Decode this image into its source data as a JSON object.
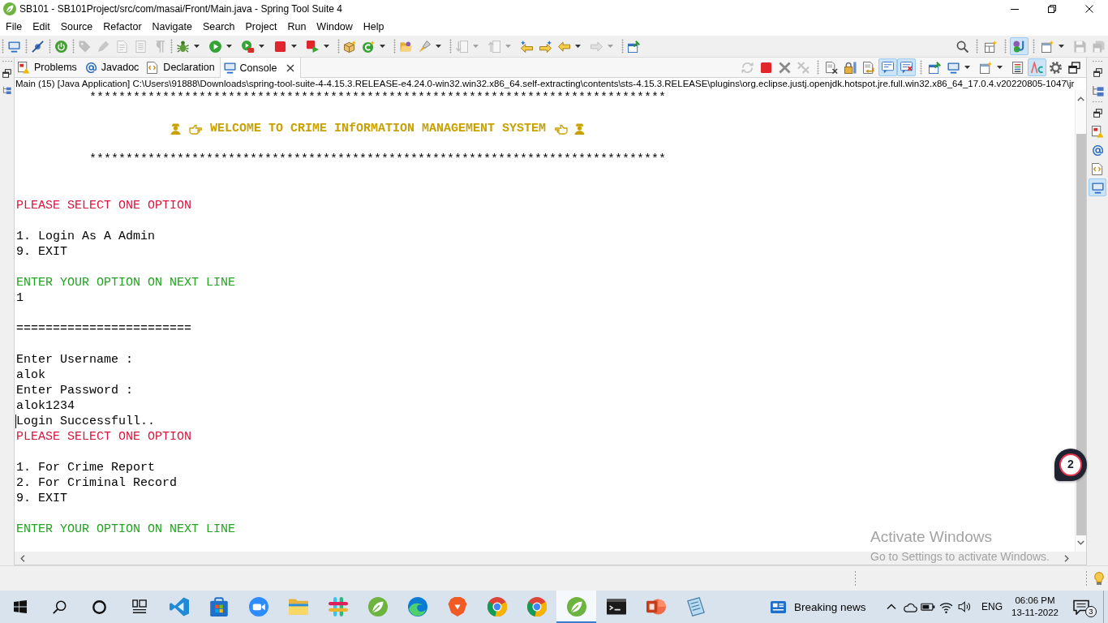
{
  "window": {
    "title": "SB101 - SB101Project/src/com/masai/Front/Main.java - Spring Tool Suite 4"
  },
  "menu": [
    "File",
    "Edit",
    "Source",
    "Refactor",
    "Navigate",
    "Search",
    "Project",
    "Run",
    "Window",
    "Help"
  ],
  "main_toolbar": {
    "left": [
      {
        "kind": "separator"
      },
      {
        "kind": "console",
        "disabled": false
      },
      {
        "kind": "separator"
      },
      {
        "kind": "skip-breakpoints",
        "disabled": false
      },
      {
        "kind": "separator"
      },
      {
        "kind": "dashboard",
        "disabled": false
      },
      {
        "kind": "separator"
      },
      {
        "kind": "annotation",
        "disabled": true
      },
      {
        "kind": "highlight",
        "disabled": true
      },
      {
        "kind": "format",
        "disabled": true
      },
      {
        "kind": "block-selection",
        "disabled": true
      },
      {
        "kind": "whitespace",
        "disabled": true
      },
      {
        "kind": "separator"
      },
      {
        "kind": "debug",
        "disabled": false,
        "dropdown": true
      },
      {
        "kind": "run",
        "disabled": false,
        "dropdown": true
      },
      {
        "kind": "coverage",
        "disabled": false,
        "dropdown": true
      },
      {
        "kind": "terminate",
        "disabled": false,
        "dropdown": true
      },
      {
        "kind": "launch",
        "disabled": false,
        "dropdown": true
      },
      {
        "kind": "separator"
      },
      {
        "kind": "new-package",
        "disabled": false
      },
      {
        "kind": "new-class",
        "disabled": false,
        "dropdown": true
      },
      {
        "kind": "separator"
      },
      {
        "kind": "open-type",
        "disabled": false
      },
      {
        "kind": "search",
        "disabled": false,
        "dropdown": true
      },
      {
        "kind": "separator"
      },
      {
        "kind": "next-annotation",
        "disabled": true,
        "dropdown": true
      },
      {
        "kind": "previous-annotation",
        "disabled": true,
        "dropdown": true
      },
      {
        "kind": "last-edit",
        "disabled": false
      },
      {
        "kind": "next-edit",
        "disabled": false
      },
      {
        "kind": "back",
        "disabled": false,
        "dropdown": true
      },
      {
        "kind": "forward",
        "disabled": true,
        "dropdown": true
      },
      {
        "kind": "separator"
      },
      {
        "kind": "pin-editor",
        "disabled": false
      }
    ],
    "right": [
      {
        "kind": "find",
        "disabled": false,
        "pressed": false
      },
      {
        "kind": "separator"
      },
      {
        "kind": "open-perspective",
        "disabled": false,
        "pressed": false
      },
      {
        "kind": "separator"
      },
      {
        "kind": "perspective",
        "disabled": false,
        "pressed": true
      },
      {
        "kind": "separator"
      },
      {
        "kind": "new-window",
        "disabled": false,
        "pressed": false,
        "dropdown": true
      },
      {
        "kind": "save",
        "disabled": true,
        "pressed": false
      },
      {
        "kind": "save-all",
        "disabled": true,
        "pressed": false
      }
    ]
  },
  "left_trim": [
    {
      "kind": "restore"
    },
    {
      "kind": "outline"
    }
  ],
  "views": {
    "tabs": [
      {
        "label": "Problems",
        "kind": "problems",
        "selected": false
      },
      {
        "label": "Javadoc",
        "kind": "javadoc",
        "selected": false
      },
      {
        "label": "Declaration",
        "kind": "declaration",
        "selected": false
      },
      {
        "label": "Console",
        "kind": "console",
        "selected": true
      }
    ],
    "toolbar": [
      {
        "kind": "sync",
        "disabled": true,
        "pressed": false
      },
      {
        "kind": "terminate",
        "disabled": false,
        "pressed": false
      },
      {
        "kind": "remove",
        "disabled": false,
        "pressed": false
      },
      {
        "kind": "remove-all",
        "disabled": true,
        "pressed": false
      },
      {
        "kind": "separator"
      },
      {
        "kind": "clear",
        "disabled": false,
        "pressed": false
      },
      {
        "kind": "scroll-lock",
        "disabled": false,
        "pressed": false
      },
      {
        "kind": "word-wrap",
        "disabled": false,
        "pressed": false
      },
      {
        "kind": "stdout",
        "disabled": false,
        "pressed": true
      },
      {
        "kind": "stderr",
        "disabled": false,
        "pressed": true
      },
      {
        "kind": "separator"
      },
      {
        "kind": "pin",
        "disabled": false,
        "pressed": false
      },
      {
        "kind": "display-console",
        "disabled": false,
        "pressed": false,
        "dropdown": true
      },
      {
        "kind": "open-console",
        "disabled": false,
        "pressed": false,
        "dropdown": true
      },
      {
        "kind": "output",
        "disabled": false,
        "pressed": false
      },
      {
        "kind": "ansi",
        "disabled": false,
        "pressed": true
      },
      {
        "kind": "preferences",
        "disabled": false,
        "pressed": false
      },
      {
        "kind": "restore",
        "disabled": false,
        "pressed": false
      }
    ]
  },
  "console": {
    "description": "Main (15) [Java Application] C:\\Users\\91888\\Downloads\\spring-tool-suite-4-4.15.3.RELEASE-e4.24.0-win32.win32.x86_64.self-extracting\\contents\\sts-4.15.3.RELEASE\\plugins\\org.eclipse.justj.openjdk.hotspot.jre.full.win32.x86_64_17.0.4.v20220805-1047\\jr",
    "lines": [
      {
        "kind": "rule",
        "text": "*******************************************************************************"
      },
      {
        "kind": "blank"
      },
      {
        "kind": "banner",
        "text": "WELCOME TO CRIME INfORMATION MANAGEMENT SYSTEM"
      },
      {
        "kind": "blank"
      },
      {
        "kind": "rule",
        "text": "*******************************************************************************"
      },
      {
        "kind": "blank"
      },
      {
        "kind": "blank"
      },
      {
        "kind": "heading",
        "text": "PLEASE SELECT ONE OPTION"
      },
      {
        "kind": "blank"
      },
      {
        "kind": "text",
        "text": "1. Login As A Admin"
      },
      {
        "kind": "text",
        "text": "9. EXIT"
      },
      {
        "kind": "blank"
      },
      {
        "kind": "prompt",
        "text": "ENTER YOUR OPTION ON NEXT LINE"
      },
      {
        "kind": "text",
        "text": "1"
      },
      {
        "kind": "blank"
      },
      {
        "kind": "text",
        "text": "========================"
      },
      {
        "kind": "blank"
      },
      {
        "kind": "text",
        "text": "Enter Username :"
      },
      {
        "kind": "text",
        "text": "alok"
      },
      {
        "kind": "text",
        "text": "Enter Password :"
      },
      {
        "kind": "text",
        "text": "alok1234"
      },
      {
        "kind": "text",
        "text": "Login Successfull..",
        "caret": true
      },
      {
        "kind": "heading",
        "text": "PLEASE SELECT ONE OPTION"
      },
      {
        "kind": "blank"
      },
      {
        "kind": "text",
        "text": "1. For Crime Report"
      },
      {
        "kind": "text",
        "text": "2. For Criminal Record"
      },
      {
        "kind": "text",
        "text": "9. EXIT"
      },
      {
        "kind": "blank"
      },
      {
        "kind": "prompt",
        "text": "ENTER YOUR OPTION ON NEXT LINE"
      }
    ]
  },
  "right_trim": [
    {
      "kind": "restore",
      "selected": false
    },
    {
      "kind": "outline",
      "selected": false
    },
    {
      "kind": "separator"
    },
    {
      "kind": "restore",
      "selected": false
    },
    {
      "kind": "problems",
      "selected": false
    },
    {
      "kind": "javadoc",
      "selected": false
    },
    {
      "kind": "declaration",
      "selected": false
    },
    {
      "kind": "console",
      "selected": true
    }
  ],
  "floating_counter": {
    "count": "2"
  },
  "activation_notice": {
    "title": "Activate Windows",
    "message": "Go to Settings to activate Windows."
  },
  "taskbar": {
    "apps": [
      {
        "kind": "start",
        "selected": false
      },
      {
        "kind": "search",
        "selected": false
      },
      {
        "kind": "assistant",
        "selected": false
      },
      {
        "kind": "task-view",
        "selected": false
      },
      {
        "kind": "code-editor",
        "selected": false
      },
      {
        "kind": "store",
        "selected": false
      },
      {
        "kind": "meetings",
        "selected": false
      },
      {
        "kind": "files",
        "selected": false
      },
      {
        "kind": "chat",
        "selected": false
      },
      {
        "kind": "ide",
        "selected": false
      },
      {
        "kind": "edge",
        "selected": false
      },
      {
        "kind": "brave",
        "selected": false
      },
      {
        "kind": "chrome",
        "selected": false
      },
      {
        "kind": "chrome",
        "selected": false
      },
      {
        "kind": "ide",
        "selected": true
      },
      {
        "kind": "terminal",
        "selected": false
      },
      {
        "kind": "slides",
        "selected": false
      },
      {
        "kind": "notepad",
        "selected": false
      }
    ],
    "news": {
      "label": "Breaking news"
    },
    "tray": {
      "language": "ENG",
      "time": "06:06 PM",
      "date": "13-11-2022",
      "notification_count": "3"
    }
  }
}
